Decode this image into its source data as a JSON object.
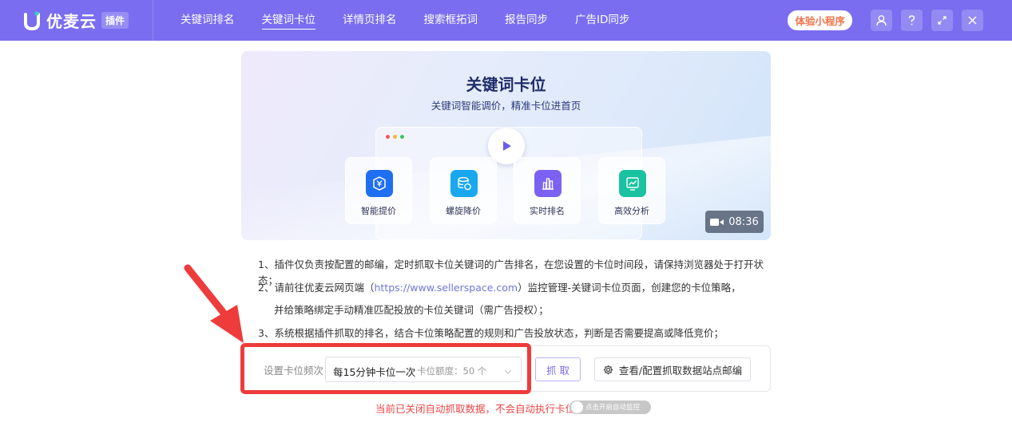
{
  "header": {
    "brand_name": "优麦云",
    "brand_tag": "插件",
    "nav": [
      {
        "label": "关键词排名",
        "active": false
      },
      {
        "label": "关键词卡位",
        "active": true
      },
      {
        "label": "详情页排名",
        "active": false
      },
      {
        "label": "搜索框拓词",
        "active": false
      },
      {
        "label": "报告同步",
        "active": false
      },
      {
        "label": "广告ID同步",
        "active": false
      }
    ],
    "mini_program_label": "体验小程序",
    "icons": [
      "user-icon",
      "help-icon",
      "expand-icon",
      "close-icon"
    ]
  },
  "banner": {
    "title": "关键词卡位",
    "subtitle": "关键词智能调价，精准卡位进首页",
    "features": [
      {
        "label": "智能提价",
        "icon": "yen-shield-icon",
        "color": "#1e6ff2"
      },
      {
        "label": "螺旋降价",
        "icon": "coins-icon",
        "color": "#19a7f0"
      },
      {
        "label": "实时排名",
        "icon": "bar-chart-icon",
        "color": "#7c62f2"
      },
      {
        "label": "高效分析",
        "icon": "analysis-icon",
        "color": "#19c2a0"
      }
    ],
    "duration": "08:36"
  },
  "notes": {
    "line1": "1、插件仅负责按配置的邮编，定时抓取卡位关键词的广告排名，在您设置的卡位时间段，请保持浏览器处于打开状态；",
    "line2_pre": "2、请前往优麦云网页端（",
    "line2_link": "https://www.sellerspace.com",
    "line2_post": "）监控管理-关键词卡位页面，创建您的卡位策略，",
    "line3": "并给策略绑定手动精准匹配投放的卡位关键词（需广告授权）；",
    "line4": "3、系统根据插件抓取的排名，结合卡位策略配置的规则和广告投放状态，判断是否需要提高或降低竞价；"
  },
  "settings": {
    "frequency_label": "设置卡位频次",
    "frequency_value": "每15分钟卡位一次",
    "quota_label": "卡位额度：50 个",
    "grab_label": "抓 取",
    "config_label": "查看/配置抓取数据站点邮编"
  },
  "status": {
    "message": "当前已关闭自动抓取数据，不会自动执行卡位",
    "toggle_label": "点击开启自动监控",
    "toggle_on": false
  },
  "colors": {
    "header_bg": "#7a6df0",
    "accent": "#7a6df0",
    "annotation_red": "#ee3b3b"
  }
}
